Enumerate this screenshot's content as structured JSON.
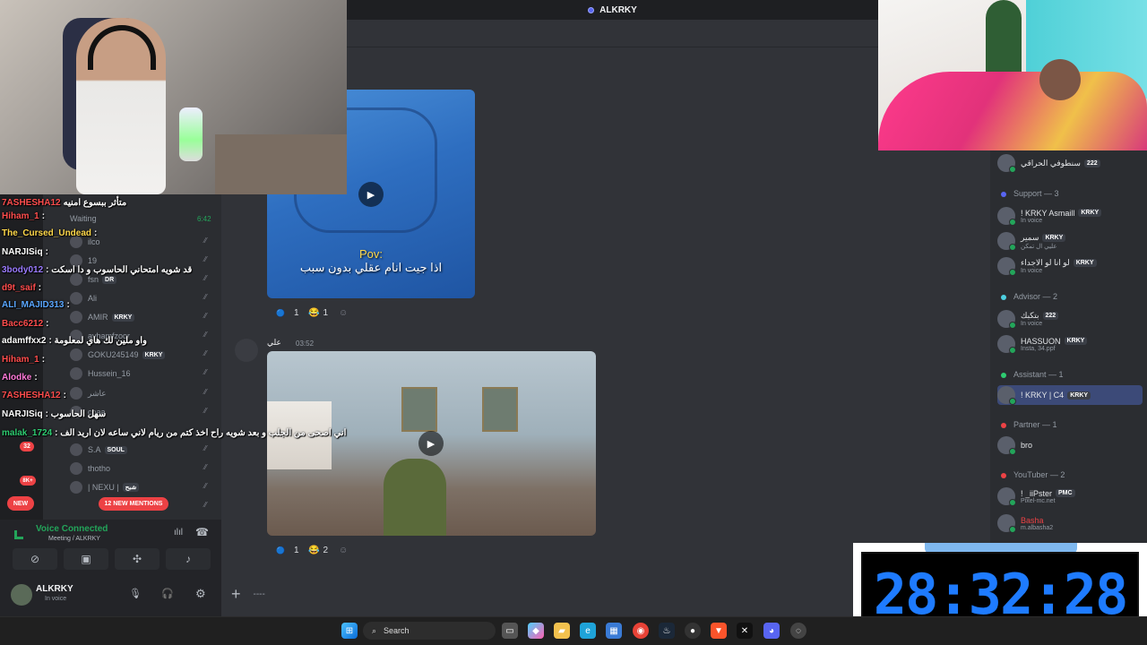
{
  "window_title": "ALKRKY",
  "chat_overlay": [
    {
      "user": "7ASHESHA12",
      "color": "#ff4d4d",
      "msg": "متأثر ببسوع امنيه"
    },
    {
      "user": "Hiham_1",
      "color": "#ff4d4d",
      "msg": ":"
    },
    {
      "user": "The_Cursed_Undead",
      "color": "#ffd84a",
      "msg": ":"
    },
    {
      "user": "NARJISiq",
      "color": "#ffffff",
      "msg": ":"
    },
    {
      "user": "3body012",
      "color": "#9b7bff",
      "msg": ": قد شويه امتحاني الحاسوب و دا اسكت"
    },
    {
      "user": "d9t_saif",
      "color": "#ff4d4d",
      "msg": ":"
    },
    {
      "user": "ALI_MAJID313",
      "color": "#5aa7ff",
      "msg": ":"
    },
    {
      "user": "Bacc6212",
      "color": "#ff4d4d",
      "msg": ":"
    },
    {
      "user": "adamffxx2",
      "color": "#ffffff",
      "msg": ": واو ملين لك هاي لمعلومة"
    },
    {
      "user": "Hiham_1",
      "color": "#ff4d4d",
      "msg": ":"
    },
    {
      "user": "Alodke",
      "color": "#ff7ad9",
      "msg": ":"
    },
    {
      "user": "7ASHESHA12",
      "color": "#ff4d4d",
      "msg": ":"
    },
    {
      "user": "NARJISiq",
      "color": "#ffffff",
      "msg": ": سهل الحاسوب"
    },
    {
      "user": "malak_1724",
      "color": "#2ecc71",
      "msg": ": اني اصحى من الجلب و بعد شويه راح اخذ كتم من ريام لاني ساعه لان اريد الف"
    }
  ],
  "voice_list": [
    {
      "name": "Waiting",
      "time": "6:42"
    },
    {
      "name": "ilco"
    },
    {
      "name": "19"
    },
    {
      "name": "fsn",
      "tag": "DR"
    },
    {
      "name": "Ali"
    },
    {
      "name": "AMIR",
      "tag": "KRKY"
    },
    {
      "name": "avhamfzoor"
    },
    {
      "name": "GOKU245149",
      "tag": "KRKY"
    },
    {
      "name": "Hussein_16"
    },
    {
      "name": "عاشر"
    },
    {
      "name": "coaa"
    },
    {
      "name": "S.A",
      "tag": "SOUL"
    },
    {
      "name": "thotho"
    },
    {
      "name": "| NEXU |",
      "tag": "شبح"
    }
  ],
  "badges": {
    "new": "NEW",
    "mentions": "12 NEW MENTIONS",
    "count32": "32",
    "count8k": "8K+"
  },
  "voice_panel": {
    "title": "Voice Connected",
    "subtitle": "Meeting / ALKRKY"
  },
  "user_panel": {
    "name": "ALKRKY",
    "status": "In voice"
  },
  "messages": [
    {
      "caption_line1": "Pov:",
      "caption_line2": "اذا جيت انام عقلي بدون سبب",
      "reactions": [
        {
          "emoji": "🔵",
          "count": "1"
        },
        {
          "emoji": "😂",
          "count": "1"
        }
      ]
    },
    {
      "author": "علي",
      "time": "03:52",
      "reactions": [
        {
          "emoji": "🔵",
          "count": "1"
        },
        {
          "emoji": "😂",
          "count": "2"
        }
      ]
    }
  ],
  "composer": {
    "placeholder": "----"
  },
  "members": {
    "top": {
      "name": "سنطوفي الحراقي",
      "tag": "222"
    },
    "roles": [
      {
        "title": "Support — 3",
        "color": "#5865f2",
        "items": [
          {
            "name": "! KRKY Asmaill",
            "tag": "KRKY",
            "sub": "In voice"
          },
          {
            "name": "سمير",
            "tag": "KRKY",
            "sub": "عليي ال تمكن"
          },
          {
            "name": "لو انا لو الاجداء",
            "tag": "KRKY",
            "sub": "In voice"
          }
        ]
      },
      {
        "title": "Advisor — 2",
        "color": "#4dd0e1",
        "items": [
          {
            "name": "بتكبك",
            "tag": "222",
            "sub": "In voice"
          },
          {
            "name": "HASSUON",
            "tag": "KRKY",
            "sub": "Insta, 34.ppf"
          }
        ]
      },
      {
        "title": "Assistant — 1",
        "color": "#2ecc71",
        "items": [
          {
            "name": "! KRKY | C4",
            "tag": "KRKY",
            "sub": ""
          }
        ]
      },
      {
        "title": "Partner — 1",
        "color": "#ed4245",
        "items": [
          {
            "name": "bro",
            "tag": "",
            "sub": ""
          }
        ]
      },
      {
        "title": "YouTuber — 2",
        "color": "#ed4245",
        "items": [
          {
            "name": "! _iiPster",
            "tag": "PMC",
            "sub": "Pixel-mc.net"
          },
          {
            "name": "Basha",
            "tag": "",
            "sub": "m.albasha2"
          }
        ]
      }
    ]
  },
  "timer": {
    "value": "28:32:28"
  },
  "taskbar": {
    "search": "Search"
  },
  "colors": {
    "bg": "#313338",
    "accent": "#5865f2",
    "timer": "#1e7bff"
  }
}
